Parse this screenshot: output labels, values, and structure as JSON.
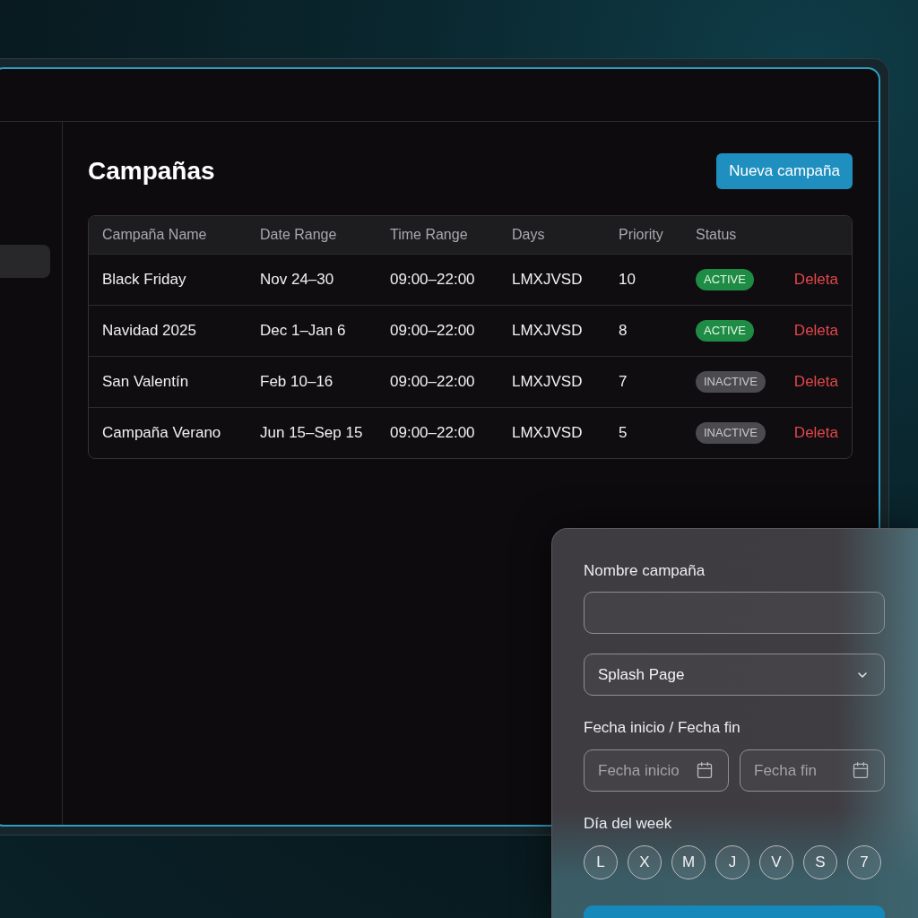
{
  "sidebar": {
    "items": [
      {
        "selected": true
      }
    ]
  },
  "page": {
    "title": "Campañas",
    "primary_button": "Nueva campaña"
  },
  "table": {
    "columns": [
      "Campaña Name",
      "Date Range",
      "Time Range",
      "Days",
      "Priority",
      "Status"
    ],
    "rows": [
      {
        "name": "Black Friday",
        "date_range": "Nov 24–30",
        "time_range": "09:00–22:00",
        "days": "LMXJVSD",
        "priority": "10",
        "status": {
          "label": "ACTIVE",
          "kind": "active"
        },
        "action": "Deleta"
      },
      {
        "name": "Navidad 2025",
        "date_range": "Dec 1–Jan 6",
        "time_range": "09:00–22:00",
        "days": "LMXJVSD",
        "priority": "8",
        "status": {
          "label": "ACTIVE",
          "kind": "active"
        },
        "action": "Deleta"
      },
      {
        "name": "San Valentín",
        "date_range": "Feb 10–16",
        "time_range": "09:00–22:00",
        "days": "LMXJVSD",
        "priority": "7",
        "status": {
          "label": "INACTIVE",
          "kind": "inactive"
        },
        "action": "Deleta"
      },
      {
        "name": "Campaña Verano",
        "date_range": "Jun 15–Sep 15",
        "time_range": "09:00–22:00",
        "days": "LMXJVSD",
        "priority": "5",
        "status": {
          "label": "INACTIVE",
          "kind": "inactive"
        },
        "action": "Deleta"
      }
    ]
  },
  "form": {
    "fields": [
      {
        "kind": "text",
        "label": "Nombre campaña"
      },
      {
        "kind": "select",
        "value": "Splash Page"
      },
      {
        "kind": "date_range",
        "label": "Fecha inicio / Fecha fin",
        "inputs": [
          {
            "placeholder": "Fecha inicio"
          },
          {
            "placeholder": "Fecha fin"
          }
        ]
      },
      {
        "kind": "days",
        "label": "Día del week",
        "options": [
          "L",
          "X",
          "M",
          "J",
          "V",
          "S",
          "7"
        ]
      },
      {
        "kind": "submit"
      }
    ]
  }
}
